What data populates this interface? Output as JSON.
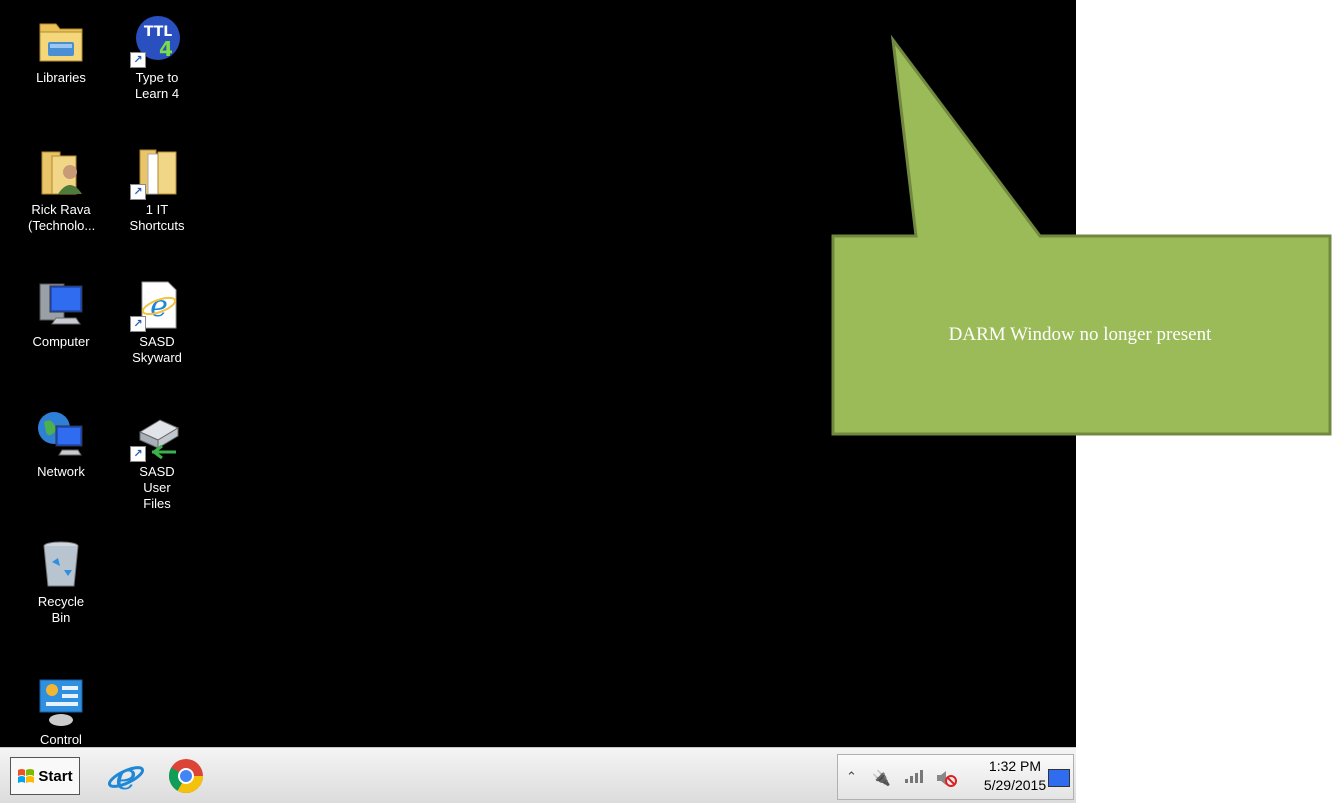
{
  "desktop_icons": [
    {
      "label": "Libraries",
      "icon": "libraries-icon",
      "shortcut": false
    },
    {
      "label": "Type to\nLearn 4",
      "icon": "type-to-learn-icon",
      "shortcut": true
    },
    {
      "label": "Rick Rava\n(Technolo...",
      "icon": "user-folder-icon",
      "shortcut": false
    },
    {
      "label": "1 IT\nShortcuts",
      "icon": "folder-icon",
      "shortcut": true
    },
    {
      "label": "Computer",
      "icon": "computer-icon",
      "shortcut": false
    },
    {
      "label": "SASD\nSkyward",
      "icon": "internet-explorer-icon",
      "shortcut": true
    },
    {
      "label": "Network",
      "icon": "network-icon",
      "shortcut": false
    },
    {
      "label": "SASD User\nFiles",
      "icon": "network-drive-icon",
      "shortcut": true
    },
    {
      "label": "Recycle Bin",
      "icon": "recycle-bin-icon",
      "shortcut": false
    },
    {
      "label": "Control",
      "icon": "control-panel-icon",
      "shortcut": false
    }
  ],
  "taskbar": {
    "start_label": "Start",
    "pinned": [
      {
        "name": "internet-explorer",
        "icon": "internet-explorer-icon"
      },
      {
        "name": "chrome",
        "icon": "chrome-icon"
      }
    ]
  },
  "tray": {
    "icons": [
      "show-hidden-icons-chevron-icon",
      "power-plug-icon",
      "network-signal-icon",
      "volume-muted-icon"
    ],
    "time": "1:32 PM",
    "date": "5/29/2015"
  },
  "callout": {
    "text": "DARM Window no longer present",
    "fill": "#9bbb59",
    "border": "#71893f"
  }
}
